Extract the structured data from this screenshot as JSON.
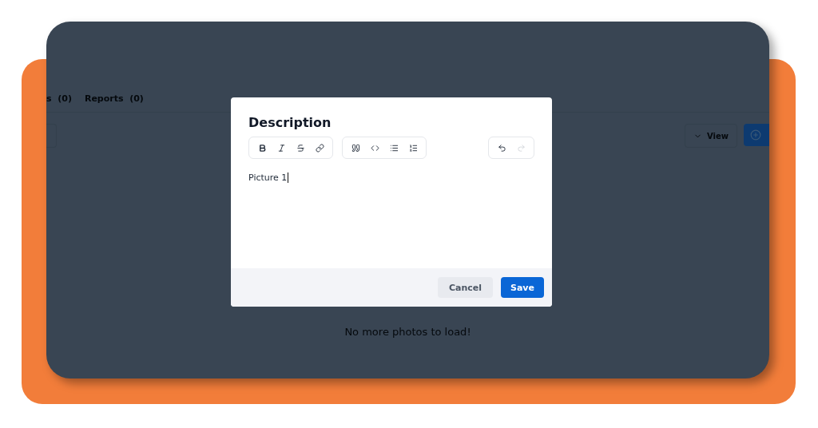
{
  "background_page": {
    "tabs": [
      {
        "label": "s",
        "count": "(0)"
      },
      {
        "label": "Reports",
        "count": "(0)"
      }
    ],
    "view_button": {
      "label": "View"
    },
    "empty_message": "No more photos to load!"
  },
  "dialog": {
    "title": "Description",
    "toolbar": [
      [
        {
          "kind": "bold",
          "disabled": false
        },
        {
          "kind": "italic",
          "disabled": false
        },
        {
          "kind": "strike",
          "disabled": false
        },
        {
          "kind": "link",
          "disabled": false
        }
      ],
      [
        {
          "kind": "quote",
          "disabled": false
        },
        {
          "kind": "code",
          "disabled": false
        },
        {
          "kind": "bullet-list",
          "disabled": false
        },
        {
          "kind": "numbered-list",
          "disabled": false
        }
      ],
      [
        {
          "kind": "undo",
          "disabled": false
        },
        {
          "kind": "redo",
          "disabled": true
        }
      ]
    ],
    "editor_text": "Picture 1",
    "buttons": [
      {
        "label": "Cancel",
        "kind": "secondary"
      },
      {
        "label": "Save",
        "kind": "primary"
      }
    ]
  }
}
